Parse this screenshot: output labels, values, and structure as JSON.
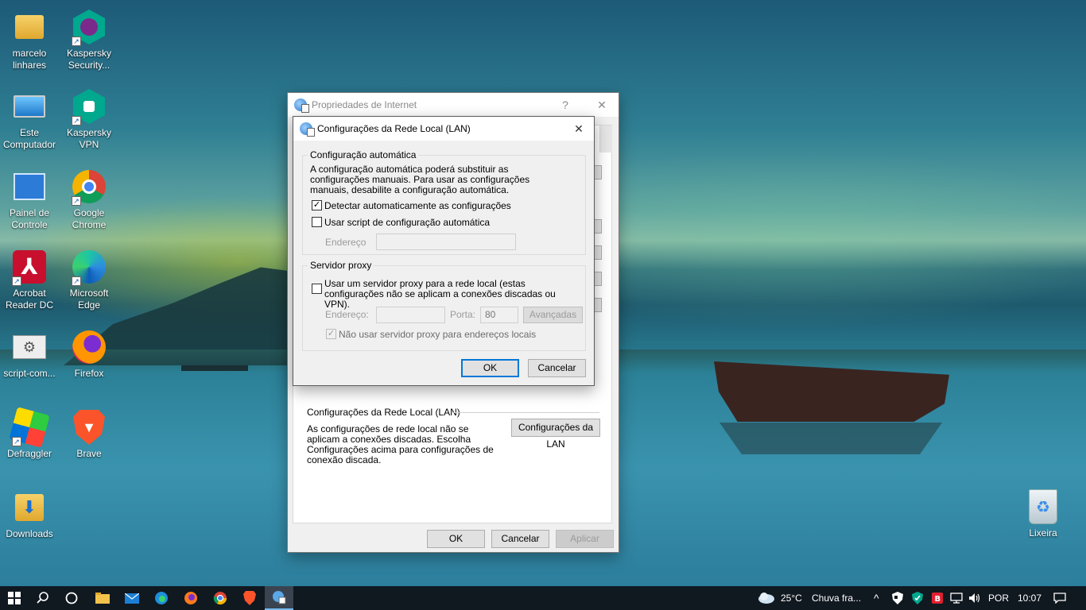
{
  "desktop": {
    "icons": [
      {
        "label": "marcelo linhares",
        "icon": "user-folder-icon"
      },
      {
        "label": "Kaspersky Security...",
        "icon": "kaspersky-security-icon"
      },
      {
        "label": "Este Computador",
        "icon": "this-pc-icon"
      },
      {
        "label": "Kaspersky VPN",
        "icon": "kaspersky-vpn-icon"
      },
      {
        "label": "Painel de Controle",
        "icon": "control-panel-icon"
      },
      {
        "label": "Google Chrome",
        "icon": "chrome-icon"
      },
      {
        "label": "Acrobat Reader DC",
        "icon": "acrobat-icon"
      },
      {
        "label": "Microsoft Edge",
        "icon": "edge-icon"
      },
      {
        "label": "script-com...",
        "icon": "script-file-icon"
      },
      {
        "label": "Firefox",
        "icon": "firefox-icon"
      },
      {
        "label": "Defraggler",
        "icon": "defraggler-icon"
      },
      {
        "label": "Brave",
        "icon": "brave-icon"
      },
      {
        "label": "Downloads",
        "icon": "downloads-folder-icon"
      },
      {
        "label": "Lixeira",
        "icon": "recycle-bin-icon"
      }
    ]
  },
  "internet_properties": {
    "title": "Propriedades de Internet",
    "help": "?",
    "close": "✕",
    "lan_section_title": "Configurações da Rede Local (LAN)",
    "lan_section_text": "As configurações de rede local não se aplicam a conexões discadas. Escolha Configurações acima para configurações de conexão discada.",
    "lan_button": "Configurações da LAN",
    "ok": "OK",
    "cancel": "Cancelar",
    "apply": "Aplicar"
  },
  "lan_dialog": {
    "title": "Configurações da Rede Local (LAN)",
    "close": "✕",
    "auto_config": {
      "legend": "Configuração automática",
      "description": "A configuração automática poderá substituir as configurações manuais. Para usar as configurações manuais, desabilite a configuração automática.",
      "detect_label": "Detectar automaticamente as configurações",
      "detect_checked": true,
      "script_label": "Usar script de configuração automática",
      "script_checked": false,
      "address_label": "Endereço",
      "address_value": ""
    },
    "proxy": {
      "legend": "Servidor proxy",
      "use_proxy_label": "Usar um servidor proxy para a rede local (estas configurações não se aplicam a conexões discadas ou VPN).",
      "use_proxy_checked": false,
      "address_label": "Endereço:",
      "address_value": "",
      "port_label": "Porta:",
      "port_value": "80",
      "advanced_label": "Avançadas",
      "bypass_label": "Não usar servidor proxy para endereços locais",
      "bypass_checked": true
    },
    "ok": "OK",
    "cancel": "Cancelar",
    "check_mark": "✓"
  },
  "taskbar": {
    "weather_temp": "25°C",
    "weather_text": "Chuva fra...",
    "language": "POR",
    "time": "10:07",
    "tray_up_arrow": "^",
    "notification_glyph": "▭"
  }
}
